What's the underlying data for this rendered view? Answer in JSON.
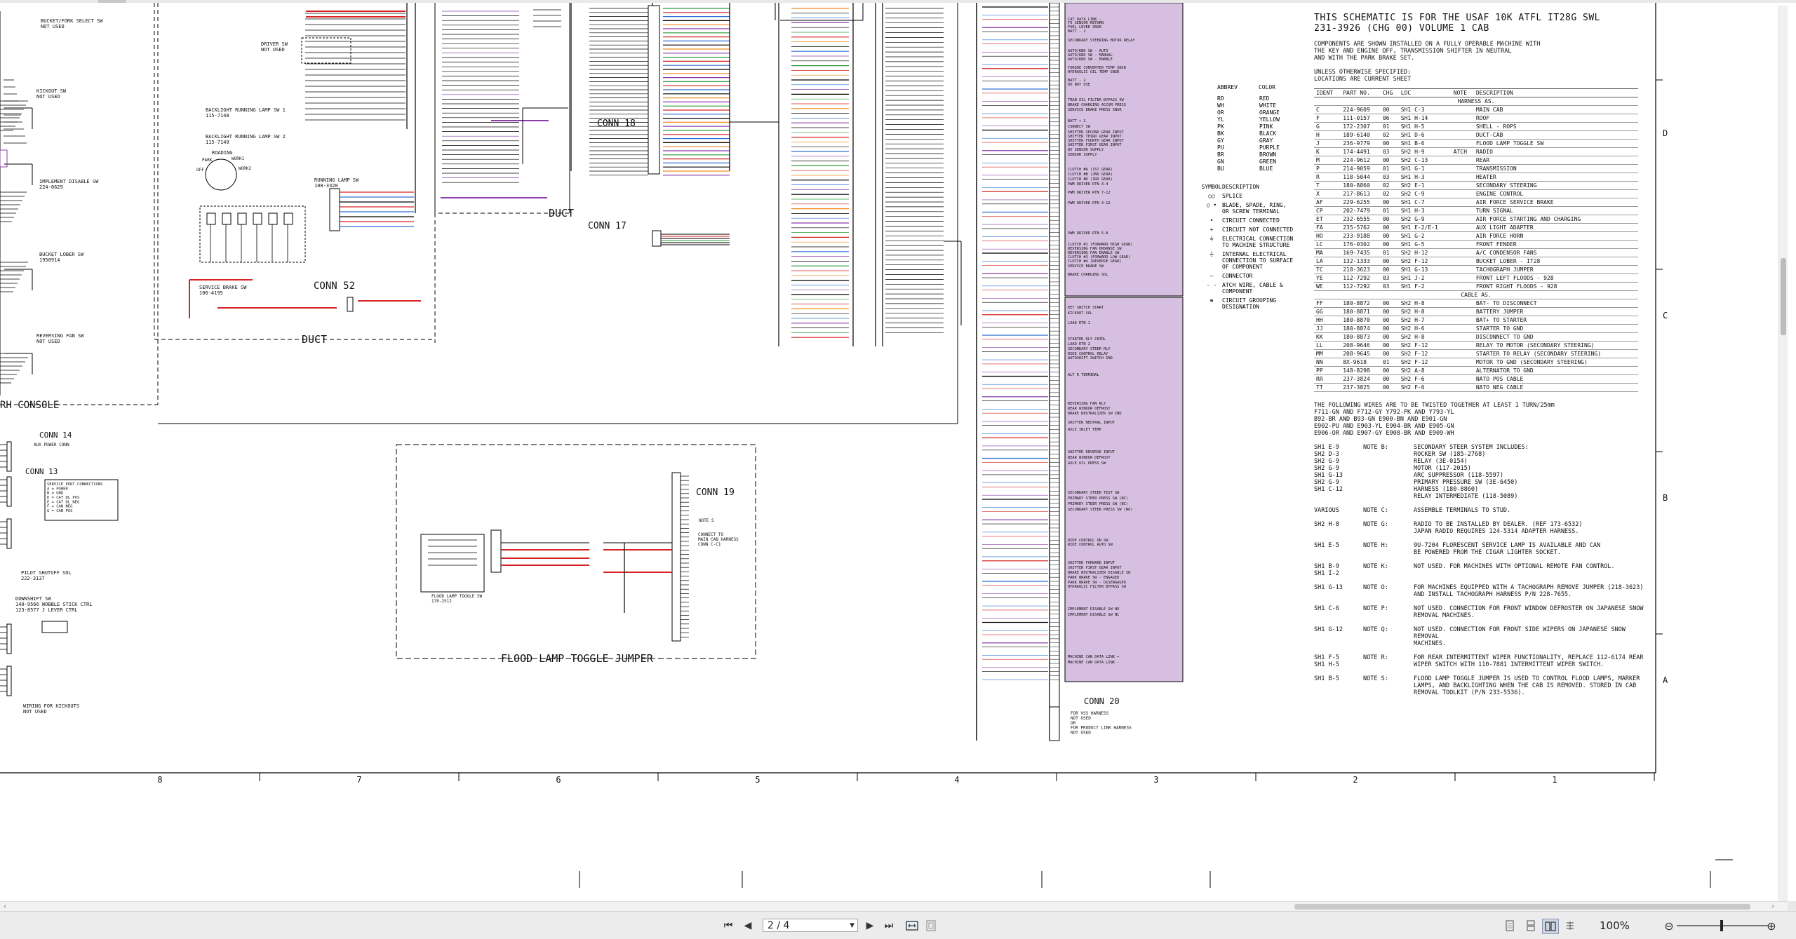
{
  "document": {
    "title": "THIS SCHEMATIC IS FOR THE USAF 10K ATFL IT28G SWL\n231-3926 (CHG 00) VOLUME 1 CAB",
    "intro": "COMPONENTS ARE SHOWN INSTALLED ON A FULLY OPERABLE MACHINE WITH\nTHE KEY AND ENGINE OFF, TRANSMISSION SHIFTER IN NEUTRAL\nAND WITH THE PARK BRAKE SET.",
    "unless": "UNLESS OTHERWISE SPECIFIED:\nLOCATIONS ARE CURRENT SHEET",
    "table_headers": [
      "IDENT",
      "PART NO.",
      "CHG",
      "LOC",
      "NOTE",
      "DESCRIPTION"
    ],
    "harness_label": "HARNESS AS.",
    "harness_rows": [
      [
        "C",
        "224-9609",
        "00",
        "SH1 C-3",
        "",
        "MAIN CAB"
      ],
      [
        "F",
        "111-0157",
        "06",
        "SH1 H-14",
        "",
        "ROOF"
      ],
      [
        "G",
        "172-2307",
        "01",
        "SH1 H-5",
        "",
        "SHELL - ROPS"
      ],
      [
        "H",
        "189-6140",
        "02",
        "SH1 D-6",
        "",
        "DUCT-CAB"
      ],
      [
        "J",
        "236-9779",
        "00",
        "SH1 B-6",
        "",
        "FLOOD LAMP TOGGLE SW"
      ],
      [
        "K",
        "174-4491",
        "03",
        "SH2 H-9",
        "ATCH",
        "RADIO"
      ],
      [
        "M",
        "224-9612",
        "00",
        "SH2 C-13",
        "",
        "REAR"
      ],
      [
        "P",
        "214-9059",
        "01",
        "SH1 G-1",
        "",
        "TRANSMISSION"
      ],
      [
        "R",
        "118-5044",
        "03",
        "SH1 H-3",
        "",
        "HEATER"
      ],
      [
        "T",
        "180-8860",
        "02",
        "SH2 E-1",
        "",
        "SECONDARY STEERING"
      ],
      [
        "X",
        "217-8613",
        "02",
        "SH2 C-9",
        "",
        "ENGINE CONTROL"
      ],
      [
        "AF",
        "229-6255",
        "00",
        "SH1 C-7",
        "",
        "AIR FORCE SERVICE BRAKE"
      ],
      [
        "CP",
        "202-7479",
        "01",
        "SH1 H-3",
        "",
        "TURN SIGNAL"
      ],
      [
        "ET",
        "232-6555",
        "00",
        "SH2 G-9",
        "",
        "AIR FORCE STARTING AND CHARGING"
      ],
      [
        "FA",
        "235-5762",
        "00",
        "SH1 E-2/E-1",
        "",
        "AUX LIGHT ADAPTER"
      ],
      [
        "HO",
        "233-9188",
        "00",
        "SH1 G-2",
        "",
        "AIR FORCE HORN"
      ],
      [
        "LC",
        "176-0302",
        "00",
        "SH1 G-5",
        "",
        "FRONT FENDER"
      ],
      [
        "MA",
        "169-7435",
        "01",
        "SH2 H-12",
        "",
        "A/C CONDENSOR FANS"
      ],
      [
        "LA",
        "132-1333",
        "00",
        "SH2 F-12",
        "",
        "BUCKET LOBER - IT28"
      ],
      [
        "TC",
        "218-3623",
        "00",
        "SH1 G-13",
        "",
        "TACHOGRAPH JUMPER"
      ],
      [
        "YE",
        "112-7292",
        "03",
        "SH1 J-2",
        "",
        "FRONT LEFT FLOODS - 928"
      ],
      [
        "WE",
        "112-7292",
        "03",
        "SH1 F-2",
        "",
        "FRONT RIGHT FLOODS - 928"
      ]
    ],
    "cable_label": "CABLE AS.",
    "cable_rows": [
      [
        "FF",
        "180-8872",
        "00",
        "SH2 H-8",
        "",
        "BAT- TO DISCONNECT"
      ],
      [
        "GG",
        "180-8871",
        "00",
        "SH2 H-8",
        "",
        "BATTERY JUMPER"
      ],
      [
        "HH",
        "180-8870",
        "00",
        "SH2 H-7",
        "",
        "BAT+ TO STARTER"
      ],
      [
        "JJ",
        "180-8874",
        "00",
        "SH2 H-6",
        "",
        "STARTER TO GND"
      ],
      [
        "KK",
        "180-8873",
        "00",
        "SH2 H-8",
        "",
        "DISCONNECT TO GND"
      ],
      [
        "LL",
        "208-9646",
        "00",
        "SH2 F-12",
        "",
        "RELAY TO MOTOR (SECONDARY STEERING)"
      ],
      [
        "MM",
        "208-9645",
        "00",
        "SH2 F-12",
        "",
        "STARTER TO RELAY (SECONDARY STEERING)"
      ],
      [
        "NN",
        "8X-9618",
        "01",
        "SH2 F-12",
        "",
        "MOTOR TO GND (SECONDARY STEERING)"
      ],
      [
        "PP",
        "148-8298",
        "00",
        "SH2 A-8",
        "",
        "ALTERNATOR TO GND"
      ],
      [
        "RR",
        "237-3824",
        "00",
        "SH2 F-6",
        "",
        "NATO POS CABLE"
      ],
      [
        "TT",
        "237-3825",
        "00",
        "SH2 F-6",
        "",
        "NATO NEG CABLE"
      ]
    ],
    "twist_note": "THE FOLLOWING WIRES ARE TO BE TWISTED TOGETHER AT LEAST 1 TURN/25mm\nF711-GN AND F712-GY      Y792-PK AND Y793-YL\nB92-BR AND B93-GN        E900-BN AND E901-GN\nE902-PU AND E903-YL      E904-BR AND E905-GN\nE906-OR AND E907-GY      E908-BR AND E909-WH",
    "notes": [
      {
        "loc": "SH1 E-9\nSH2 D-3\nSH2 G-9\nSH2 G-9\nSH1 G-13\nSH2 G-9\nSH1 C-12",
        "note": "NOTE B:",
        "text": "SECONDARY STEER SYSTEM INCLUDES:\n  ROCKER SW  (185-2768)\n  RELAY  (3E-0154)\n  MOTOR  (117-2015)\n  ARC SUPPRESSOR  (118-5597)\n  PRIMARY PRESSURE SW  (3E-6450)\n  HARNESS (180-8860)\n  RELAY INTERMEDIATE (118-5089)"
      },
      {
        "loc": "VARIOUS",
        "note": "NOTE C:",
        "text": "ASSEMBLE TERMINALS TO STUD."
      },
      {
        "loc": "SH2 H-8",
        "note": "NOTE G:",
        "text": "RADIO TO BE INSTALLED BY DEALER. (REF 173-6532)\nJAPAN RADIO REQUIRES 124-5314 ADAPTER HARNESS."
      },
      {
        "loc": "SH1 E-5",
        "note": "NOTE H:",
        "text": "9U-7204 FLORESCENT SERVICE LAMP IS AVAILABLE AND CAN\nBE POWERED FROM THE CIGAR LIGHTER SOCKET."
      },
      {
        "loc": "SH1 B-9\nSH1 I-2",
        "note": "NOTE K:",
        "text": "NOT USED.  FOR MACHINES WITH OPTIONAL REMOTE FAN CONTROL."
      },
      {
        "loc": "SH1 G-13",
        "note": "NOTE O:",
        "text": "FOR MACHINES EQUIPPED WITH A TACHOGRAPH REMOVE JUMPER (218-3623)\nAND INSTALL TACHOGRAPH HARNESS P/N 228-7655."
      },
      {
        "loc": "SH1 C-6",
        "note": "NOTE P:",
        "text": "NOT USED.  CONNECTION FOR FRONT WINDOW DEFROSTER ON JAPANESE SNOW\nREMOVAL MACHINES."
      },
      {
        "loc": "SH1 G-12",
        "note": "NOTE Q:",
        "text": "NOT USED.  CONNECTION FOR FRONT SIDE WIPERS ON JAPANESE SNOW REMOVAL\nMACHINES."
      },
      {
        "loc": "SH1 F-5\nSH1 H-5",
        "note": "NOTE R:",
        "text": "FOR REAR INTERMITTENT WIPER FUNCTIONALITY, REPLACE 112-6174 REAR\nWIPER SWITCH WITH 110-7881 INTERMITTENT WIPER SWITCH."
      },
      {
        "loc": "SH1 B-5",
        "note": "NOTE S:",
        "text": "FLOOD LAMP TOGGLE JUMPER IS USED TO CONTROL FLOOD LAMPS, MARKER\nLAMPS, AND BACKLIGHTING WHEN THE CAB IS REMOVED.  STORED IN CAB\nREMOVAL TOOLKIT (P/N 233-5536)."
      }
    ],
    "abbrev_header": [
      "ABBREV",
      "COLOR"
    ],
    "abbrev": [
      [
        "RD",
        "RED"
      ],
      [
        "WH",
        "WHITE"
      ],
      [
        "OR",
        "ORANGE"
      ],
      [
        "YL",
        "YELLOW"
      ],
      [
        "PK",
        "PINK"
      ],
      [
        "BK",
        "BLACK"
      ],
      [
        "GY",
        "GRAY"
      ],
      [
        "PU",
        "PURPLE"
      ],
      [
        "BR",
        "BROWN"
      ],
      [
        "GN",
        "GREEN"
      ],
      [
        "BU",
        "BLUE"
      ]
    ],
    "symbol_header": [
      "SYMBOL",
      "DESCRIPTION"
    ],
    "symbols": [
      [
        "○○",
        "SPLICE"
      ],
      [
        "○ •",
        "BLADE, SPADE, RING,\nOR SCREW TERMINAL"
      ],
      [
        "•",
        "CIRCUIT CONNECTED"
      ],
      [
        "+",
        "CIRCUIT NOT CONNECTED"
      ],
      [
        "⏚",
        "ELECTRICAL CONNECTION\nTO MACHINE STRUCTURE"
      ],
      [
        "⏚",
        "INTERNAL ELECTRICAL\nCONNECTION TO SURFACE\nOF COMPONENT"
      ],
      [
        "—",
        "CONNECTOR"
      ],
      [
        "- -",
        "ATCH WIRE, CABLE &\nCOMPONENT"
      ],
      [
        "≡",
        "CIRCUIT GROUPING\nDESIGNATION"
      ]
    ],
    "connectors": {
      "conn14": "CONN 14",
      "conn13": "CONN 13",
      "conn52": "CONN 52",
      "conn18": "CONN 18",
      "conn17": "CONN 17",
      "conn19": "CONN 19",
      "conn20": "CONN 20"
    },
    "labels": {
      "duct": "DUCT",
      "rh_console": "RH CONSOLE",
      "flood_jumper": "FLOOD LAMP TOGGLE JUMPER",
      "aux_power": "AUX POWER CONN",
      "service_port": "SERVICE PORT CONNECTIONS\nA = POWER\nB = GND\nD = CAT DL POS\nE = CAT DL NEG\nF = CAN NEG\nG = CAN POS",
      "bucket_fork": "BUCKET/FORK SELECT SW\nNOT USED",
      "kickout": "KICKOUT SW\nNOT USED",
      "implement_disable": "IMPLEMENT DISABLE SW\n224-8629",
      "bucket_lober": "BUCKET LOBER SW\n1958914",
      "reversing_fan": "REVERSING FAN SW\nNOT USED",
      "pilot_shutoff": "PILOT SHUTOFF SOL\n222-3137",
      "downshift": "DOWNSHIFT SW\n140-9566 WOBBLE STICK CTRL\n123-8577 J LEVER CTRL",
      "wiring_kickouts": "WIRING FOR KICKOUTS\nNOT USED",
      "driver_sw": "DRIVER SW\nNOT USED",
      "backlight1": "BACKLIGHT RUNNING LAMP SW 1\n115-7148",
      "backlight2": "BACKLIGHT RUNNING LAMP SW 2\n115-7149",
      "running_lamp": "RUNNING LAMP SW\n108-3320",
      "roading": "ROADING",
      "park": "PARK",
      "work1": "WORK1",
      "work2": "WORK2",
      "off": "OFF",
      "service_brake": "SERVICE BRAKE SW\n106-4195",
      "note_s": "NOTE S",
      "connect_main": "CONNECT TO\nMAIN CAB HARNESS\nCONN C-C1",
      "flood_toggle": "FLOOD LAMP TOGGLE SW\n170-2512",
      "conn20_notes": "FOR VSS HARNESS\nNOT USED\n\nOR\n\nFOR PRODUCT LINK HARNESS\nNOT USED"
    },
    "ecm_labels": [
      "CAT DATA LINK -",
      "TO SENSOR RETURN",
      "FUEL LEVER SNSR",
      "BATT - 2",
      "SECONDARY STEERING MOTOR RELAY",
      "AUTO/KBD SW - AUTO",
      "AUTO/KBD SW - MANUAL",
      "AUTO/KBD SW - ENABLE",
      "TORQUE CONVERTER TEMP SNSR",
      "HYDRAULIC OIL TEMP SNSR",
      "BATT - 2",
      "DO NOT USE",
      "TRAN OIL FILTER BYPASS SW",
      "BRAKE CHARGING ACCUM PRESS",
      "SERVICE BRAKE PRESS SNSR",
      "BATT + 2",
      "CONNECT SW",
      "SHIFTER SECOND GEAR INPUT",
      "SHIFTER THIRD GEAR INPUT",
      "SHIFTER FOURTH GEAR INPUT",
      "SHIFTER FIRST GEAR INPUT",
      "8V SENSOR SUPPLY",
      "SENSOR SUPPLY",
      "CLUTCH #A (1ST GEAR)",
      "CLUTCH #B (2ND GEAR)",
      "CLUTCH #D (3RD GEAR)",
      "PWM DRIVER RTN 4-4",
      "PWM DRIVER RTN 7-12",
      "PWM DRIVER RTN 4-12",
      "PWM DRIVER RTN 5-8",
      "CLUTCH #1 (FORWARD HIGH GEAR)",
      "REVERSING FAN DNSRNSE SW",
      "REVERSING FAN ENABLE SW",
      "CLUTCH #3 (FORWARD LOW GEAR)",
      "CLUTCH #4 (REVERSE GEAR)",
      "SERVICE BRAKE SW",
      "BRAKE CHARGING SOL",
      "KEY SWITCH START",
      "KICKOUT SOL",
      "LOAD RTN 1",
      "STARTER RLY CNTRL",
      "LOAD RTN 2",
      "SECONDARY STEER RLY",
      "RIDE CONTROL RELAY",
      "AUTOSHIFT SWITCH IND",
      "ALT R TERMINAL",
      "REVERSING FAN RLY",
      "REAR WINDOW DEFROST",
      "BRAKE NEUTRALIZER SW IND",
      "SHIFTER NEUTRAL INPUT",
      "AXLE INLET TEMP",
      "SHIFTER REVERSE INPUT",
      "REAR WINDOW DEFROST",
      "AXLE OIL PRESS SW",
      "SECONDARY STEER TEST SW",
      "PRIMARY STEER PRESS SW (NC)",
      "PRIMARY STEER PRESS SW (NC)",
      "SECONDARY STEER PRESS SW (NO)",
      "RIDE CONTROL ON SW",
      "RIDE CONTROL AUTO SW",
      "SHIFTER FORWARD INPUT",
      "SHIFTER FIRST GEAR INPUT",
      "BRAKE NEUTRALIZER DISABLE SW",
      "PARK BRAKE SW - ENGAGED",
      "PARK BRAKE SW - DISENGAGED",
      "HYDRAULIC FILTER BYPASS SW",
      "IMPLEMENT DISABLE SW NO",
      "IMPLEMENT DISABLE SW NC",
      "MACHINE CAN DATA LINK +",
      "MACHINE CAN DATA LINK -"
    ],
    "grid_columns": [
      "8",
      "7",
      "6",
      "5",
      "4",
      "3",
      "2",
      "1"
    ],
    "grid_rows": [
      "D",
      "C",
      "B",
      "A"
    ]
  },
  "viewer": {
    "page_display": "2 / 4",
    "zoom": "100%",
    "buttons": {
      "first": "⏮",
      "prev": "◀",
      "next": "▶",
      "last": "⏭",
      "fit_width": "fit-width-icon",
      "fit_page": "fit-page-icon",
      "single": "single-page-icon",
      "continuous": "continuous-icon",
      "double": "two-page-icon",
      "rotate": "rotate-icon",
      "zoom_out": "⊖",
      "zoom_in": "⊕"
    }
  },
  "colors": {
    "purple_block": "#d6bfe0",
    "wire_red": "#d62222",
    "wire_blue": "#2e6fd8",
    "wire_purple": "#8a3ca8",
    "wire_orange": "#f08a1c",
    "wire_green": "#2c9a3a"
  }
}
